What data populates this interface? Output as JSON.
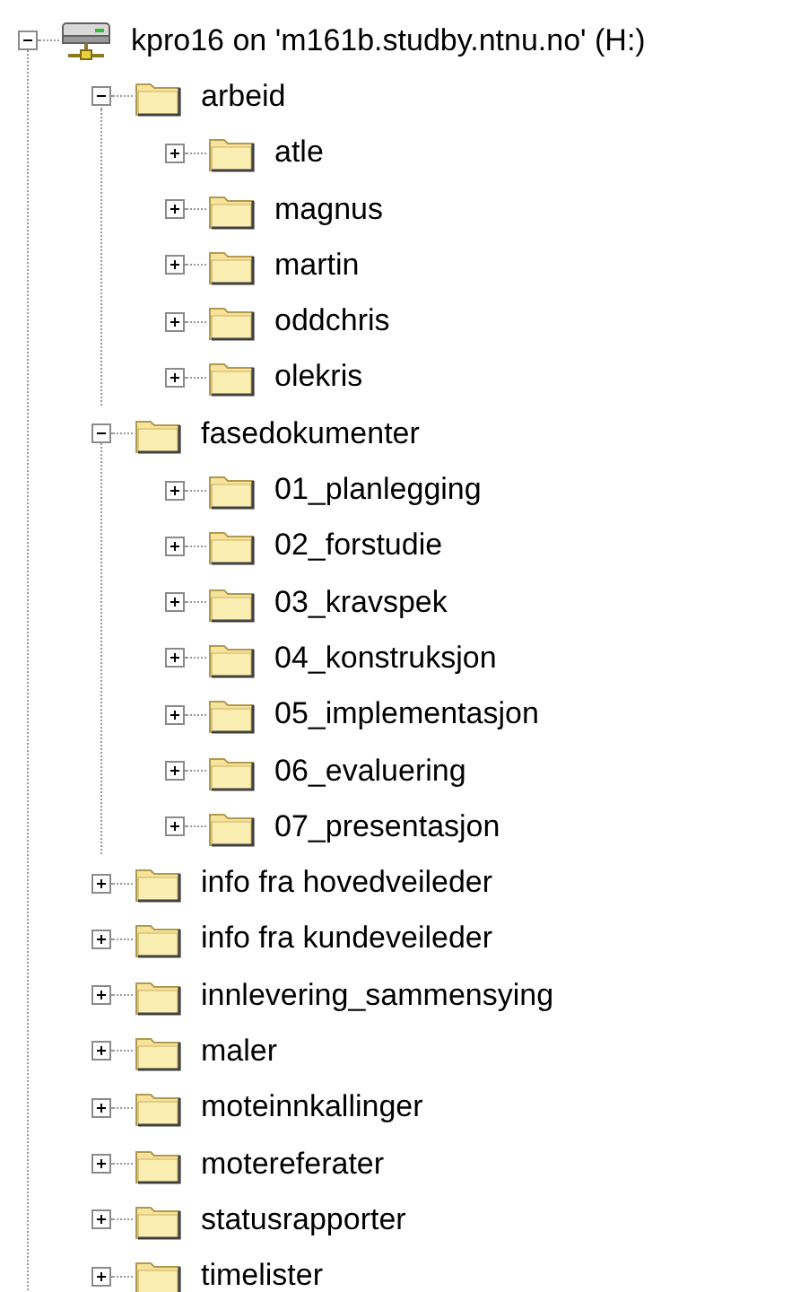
{
  "tree": [
    {
      "label": "kpro16 on 'm161b.studby.ntnu.no' (H:)",
      "kind": "drive",
      "expanded": true,
      "children": [
        {
          "label": "arbeid",
          "kind": "folder",
          "expanded": true,
          "children": [
            {
              "label": "atle",
              "kind": "folder",
              "expanded": false
            },
            {
              "label": "magnus",
              "kind": "folder",
              "expanded": false
            },
            {
              "label": "martin",
              "kind": "folder",
              "expanded": false
            },
            {
              "label": "oddchris",
              "kind": "folder",
              "expanded": false
            },
            {
              "label": "olekris",
              "kind": "folder",
              "expanded": false
            }
          ]
        },
        {
          "label": "fasedokumenter",
          "kind": "folder",
          "expanded": true,
          "children": [
            {
              "label": "01_planlegging",
              "kind": "folder",
              "expanded": false
            },
            {
              "label": "02_forstudie",
              "kind": "folder",
              "expanded": false
            },
            {
              "label": "03_kravspek",
              "kind": "folder",
              "expanded": false
            },
            {
              "label": "04_konstruksjon",
              "kind": "folder",
              "expanded": false
            },
            {
              "label": "05_implementasjon",
              "kind": "folder",
              "expanded": false
            },
            {
              "label": "06_evaluering",
              "kind": "folder",
              "expanded": false
            },
            {
              "label": "07_presentasjon",
              "kind": "folder",
              "expanded": false
            }
          ]
        },
        {
          "label": "info fra hovedveileder",
          "kind": "folder",
          "expanded": false
        },
        {
          "label": "info fra kundeveileder",
          "kind": "folder",
          "expanded": false
        },
        {
          "label": "innlevering_sammensying",
          "kind": "folder",
          "expanded": false
        },
        {
          "label": "maler",
          "kind": "folder",
          "expanded": false
        },
        {
          "label": "moteinnkallinger",
          "kind": "folder",
          "expanded": false
        },
        {
          "label": "motereferater",
          "kind": "folder",
          "expanded": false
        },
        {
          "label": "statusrapporter",
          "kind": "folder",
          "expanded": false
        },
        {
          "label": "timelister",
          "kind": "folder",
          "expanded": false
        }
      ]
    }
  ]
}
